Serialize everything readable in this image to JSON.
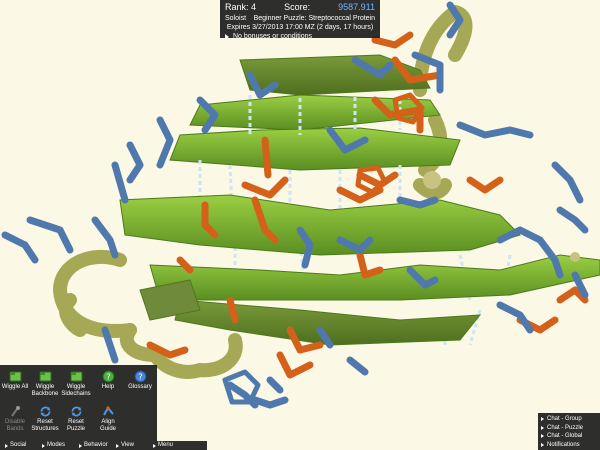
{
  "score_panel": {
    "rank_label": "Rank: 4",
    "score_label": "Score:",
    "score_value": "9587.911",
    "mode": "Soloist",
    "puzzle_name": "Beginner Puzzle: Streptococcal Protein",
    "expires": "Expires 3/27/2013 17:00 MZ (2 days, 17 hours)",
    "bonuses": "No bonuses or conditions"
  },
  "tools": {
    "wiggle_all": "Wiggle All",
    "wiggle_backbone": "Wiggle Backbone",
    "wiggle_sidechains": "Wiggle Sidechains",
    "help": "Help",
    "glossary": "Glossary",
    "disable_bands": "Disable Bands",
    "reset_structures": "Reset Structures",
    "reset_puzzle": "Reset Puzzle",
    "align_guide": "Align Guide"
  },
  "menu": [
    "Social",
    "Modes",
    "Behavior",
    "View",
    "Menu"
  ],
  "chat": [
    "Chat - Group",
    "Chat - Puzzle",
    "Chat - Global",
    "Notifications"
  ],
  "colors": {
    "background": "#fbf8e6",
    "sheet_green": "#7cb436",
    "backbone_olive": "#a7a855",
    "sidechain_blue": "#4f79ad",
    "sidechain_orange": "#d3611a",
    "hbond_light_blue": "#cfe4f5",
    "score_value": "#6fb7ff"
  }
}
